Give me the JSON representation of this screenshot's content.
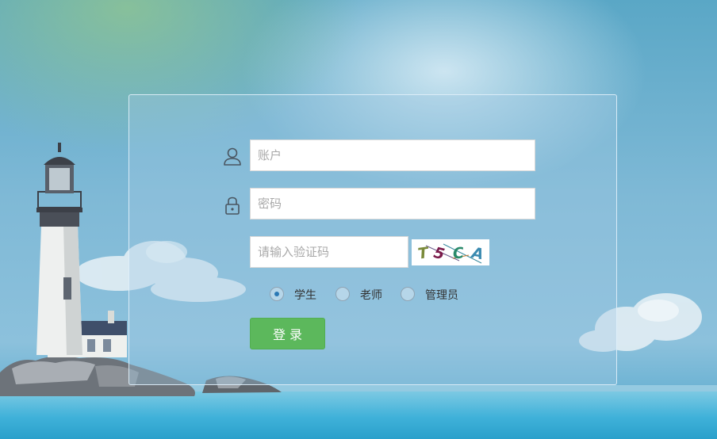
{
  "form": {
    "account_placeholder": "账户",
    "password_placeholder": "密码",
    "captcha_placeholder": "请输入验证码",
    "captcha_image_text": "T5CA",
    "roles": [
      {
        "label": "学生",
        "checked": true
      },
      {
        "label": "老师",
        "checked": false
      },
      {
        "label": "管理员",
        "checked": false
      }
    ],
    "login_label": "登 录"
  },
  "icons": {
    "account": "user-icon",
    "password": "lock-icon"
  },
  "colors": {
    "login_button": "#5cb85c",
    "radio_selected": "#2b79b5"
  }
}
